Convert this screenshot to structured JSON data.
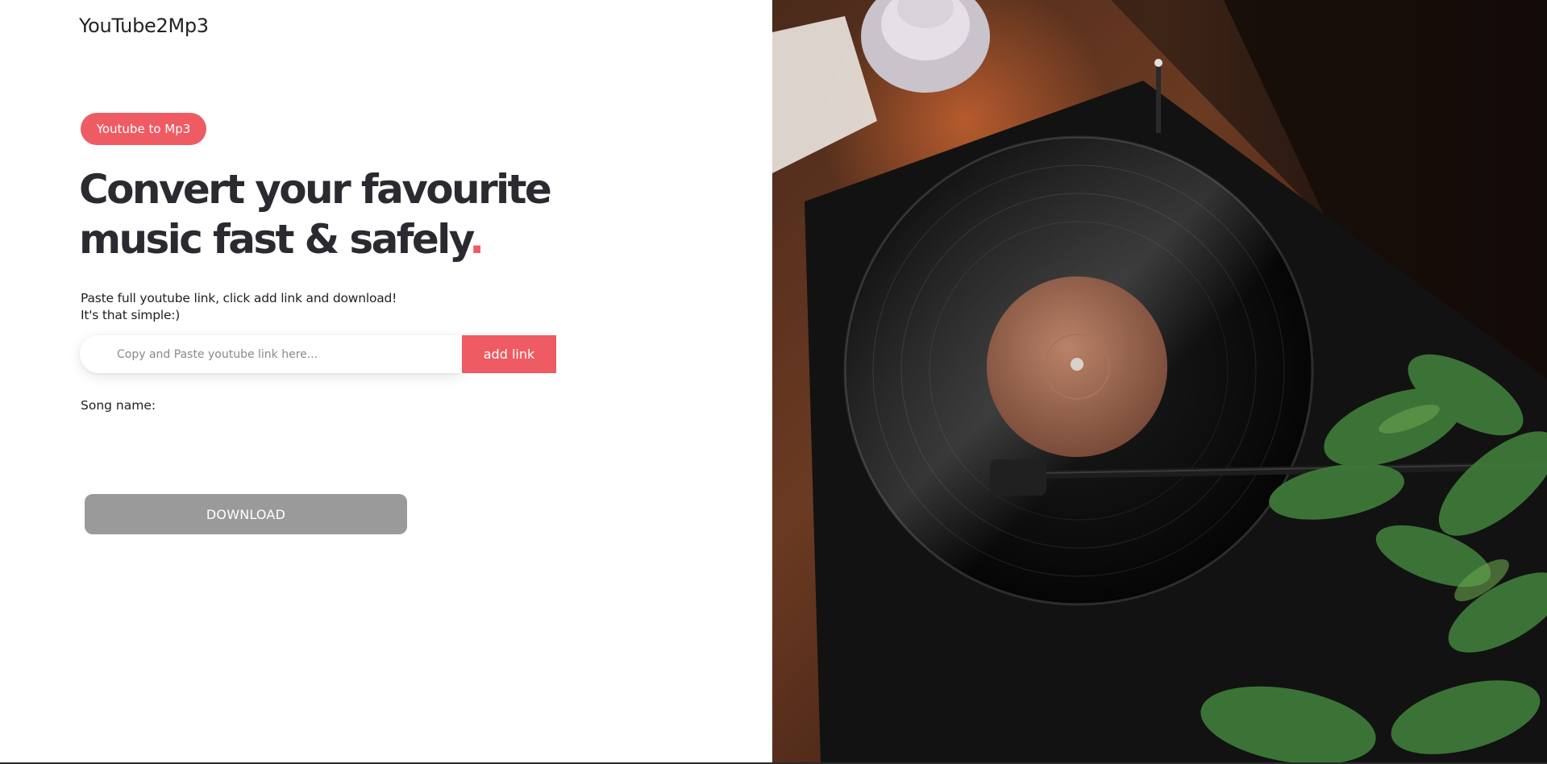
{
  "header": {
    "logo": "YouTube2Mp3"
  },
  "hero": {
    "badge": "Youtube to Mp3",
    "headline_line1": "Convert your favourite",
    "headline_line2": "music fast & safely",
    "headline_dot": ".",
    "accent_color": "#ef5b63"
  },
  "instructions": {
    "line1": "Paste full youtube link, click add link and download!",
    "line2": "It's that simple:)"
  },
  "link_form": {
    "input_value": "",
    "input_placeholder": "Copy and Paste youtube link here...",
    "add_button_label": "add link"
  },
  "song": {
    "label": "Song name:",
    "value": ""
  },
  "download": {
    "button_label": "DOWNLOAD",
    "button_color": "#9a9a9a"
  },
  "hero_image": {
    "subject": "vinyl-record-player-photo"
  }
}
